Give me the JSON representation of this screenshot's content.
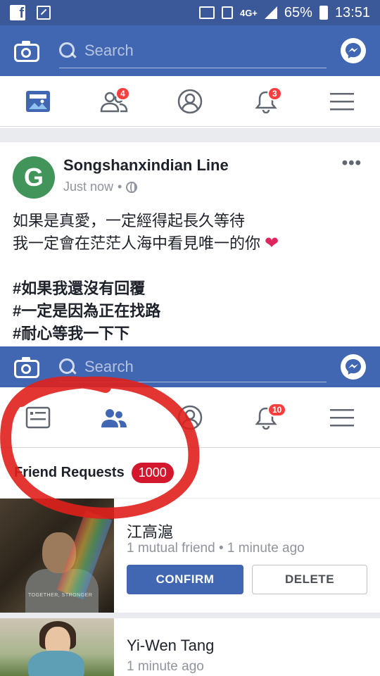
{
  "status_bar": {
    "battery": "65%",
    "time": "13:51",
    "network": "4G+"
  },
  "top_bar": {
    "search_placeholder": "Search"
  },
  "tabs": {
    "friend_badge": "4",
    "notification_badge": "3"
  },
  "post": {
    "author_initial": "G",
    "author": "Songshanxindian Line",
    "time": "Just now",
    "lines": [
      "如果是真愛，一定經得起長久等待",
      "我一定會在茫茫人海中看見唯一的你"
    ],
    "hashtags": [
      "#如果我還沒有回覆",
      "#一定是因為正在找路",
      "#耐心等我一下下"
    ]
  },
  "second_screen": {
    "search_placeholder": "Search",
    "notification_badge": "10",
    "friend_requests": {
      "title": "Friend Requests",
      "count": "1000",
      "items": [
        {
          "name": "江高滬",
          "subtitle": "1 mutual friend • 1 minute ago",
          "photo_caption": "TOGETHER, STRONGER",
          "confirm_label": "CONFIRM",
          "delete_label": "DELETE"
        },
        {
          "name": "Yi-Wen Tang",
          "subtitle": "1 minute ago"
        }
      ]
    }
  },
  "colors": {
    "brand": "#4267b2",
    "status_bar": "#3b5998",
    "badge": "#fa3e3e",
    "annotation": "#e0201c"
  },
  "icons": {
    "status_left": [
      "facebook-icon",
      "picture-in-picture-icon"
    ],
    "status_right": [
      "cast-icon",
      "vibrate-icon",
      "signal-icon",
      "battery-icon"
    ],
    "top_bar": [
      "camera-icon",
      "search-icon",
      "messenger-icon"
    ],
    "tabs": [
      "news-feed-icon",
      "friends-icon",
      "profile-icon",
      "notifications-icon",
      "menu-icon"
    ]
  }
}
